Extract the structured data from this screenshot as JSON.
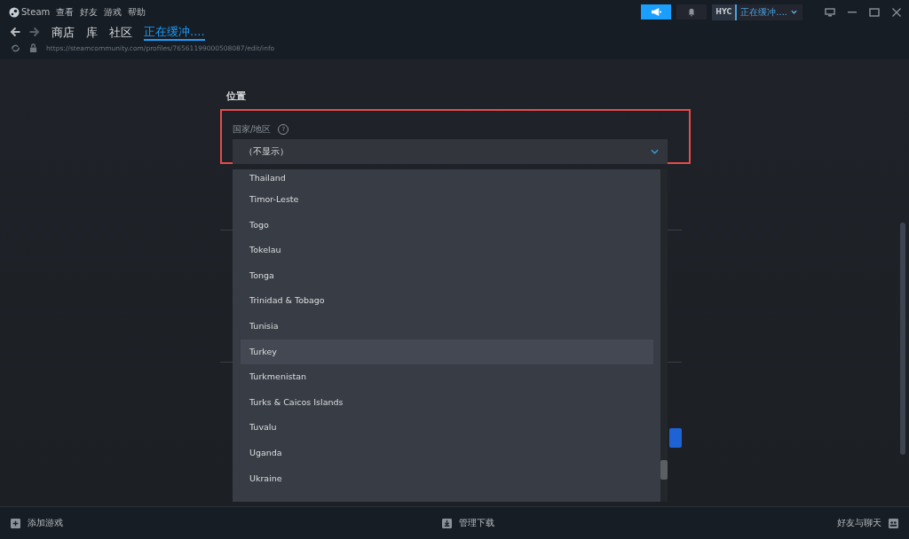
{
  "menu": [
    "Steam",
    "查看",
    "好友",
    "游戏",
    "帮助"
  ],
  "nav_tabs": [
    {
      "label": "商店",
      "selected": false
    },
    {
      "label": "库",
      "selected": false
    },
    {
      "label": "社区",
      "selected": false
    },
    {
      "label": "正在缓冲....",
      "selected": true
    }
  ],
  "url": "https://steamcommunity.com/profiles/76561199000508087/edit/info",
  "account": {
    "avatar_text": "HYC",
    "name": "正在缓冲...."
  },
  "section_title": "位置",
  "field": {
    "label": "国家/地区",
    "help": "?",
    "value": "（不显示）"
  },
  "options": [
    {
      "label": "Thailand",
      "selected": false
    },
    {
      "label": "Timor-Leste",
      "selected": false
    },
    {
      "label": "Togo",
      "selected": false
    },
    {
      "label": "Tokelau",
      "selected": false
    },
    {
      "label": "Tonga",
      "selected": false
    },
    {
      "label": "Trinidad & Tobago",
      "selected": false
    },
    {
      "label": "Tunisia",
      "selected": false
    },
    {
      "label": "Turkey",
      "selected": true
    },
    {
      "label": "Turkmenistan",
      "selected": false
    },
    {
      "label": "Turks & Caicos Islands",
      "selected": false
    },
    {
      "label": "Tuvalu",
      "selected": false
    },
    {
      "label": "Uganda",
      "selected": false
    },
    {
      "label": "Ukraine",
      "selected": false
    }
  ],
  "footer": {
    "left": "添加游戏",
    "center": "管理下载",
    "right": "好友与聊天"
  }
}
